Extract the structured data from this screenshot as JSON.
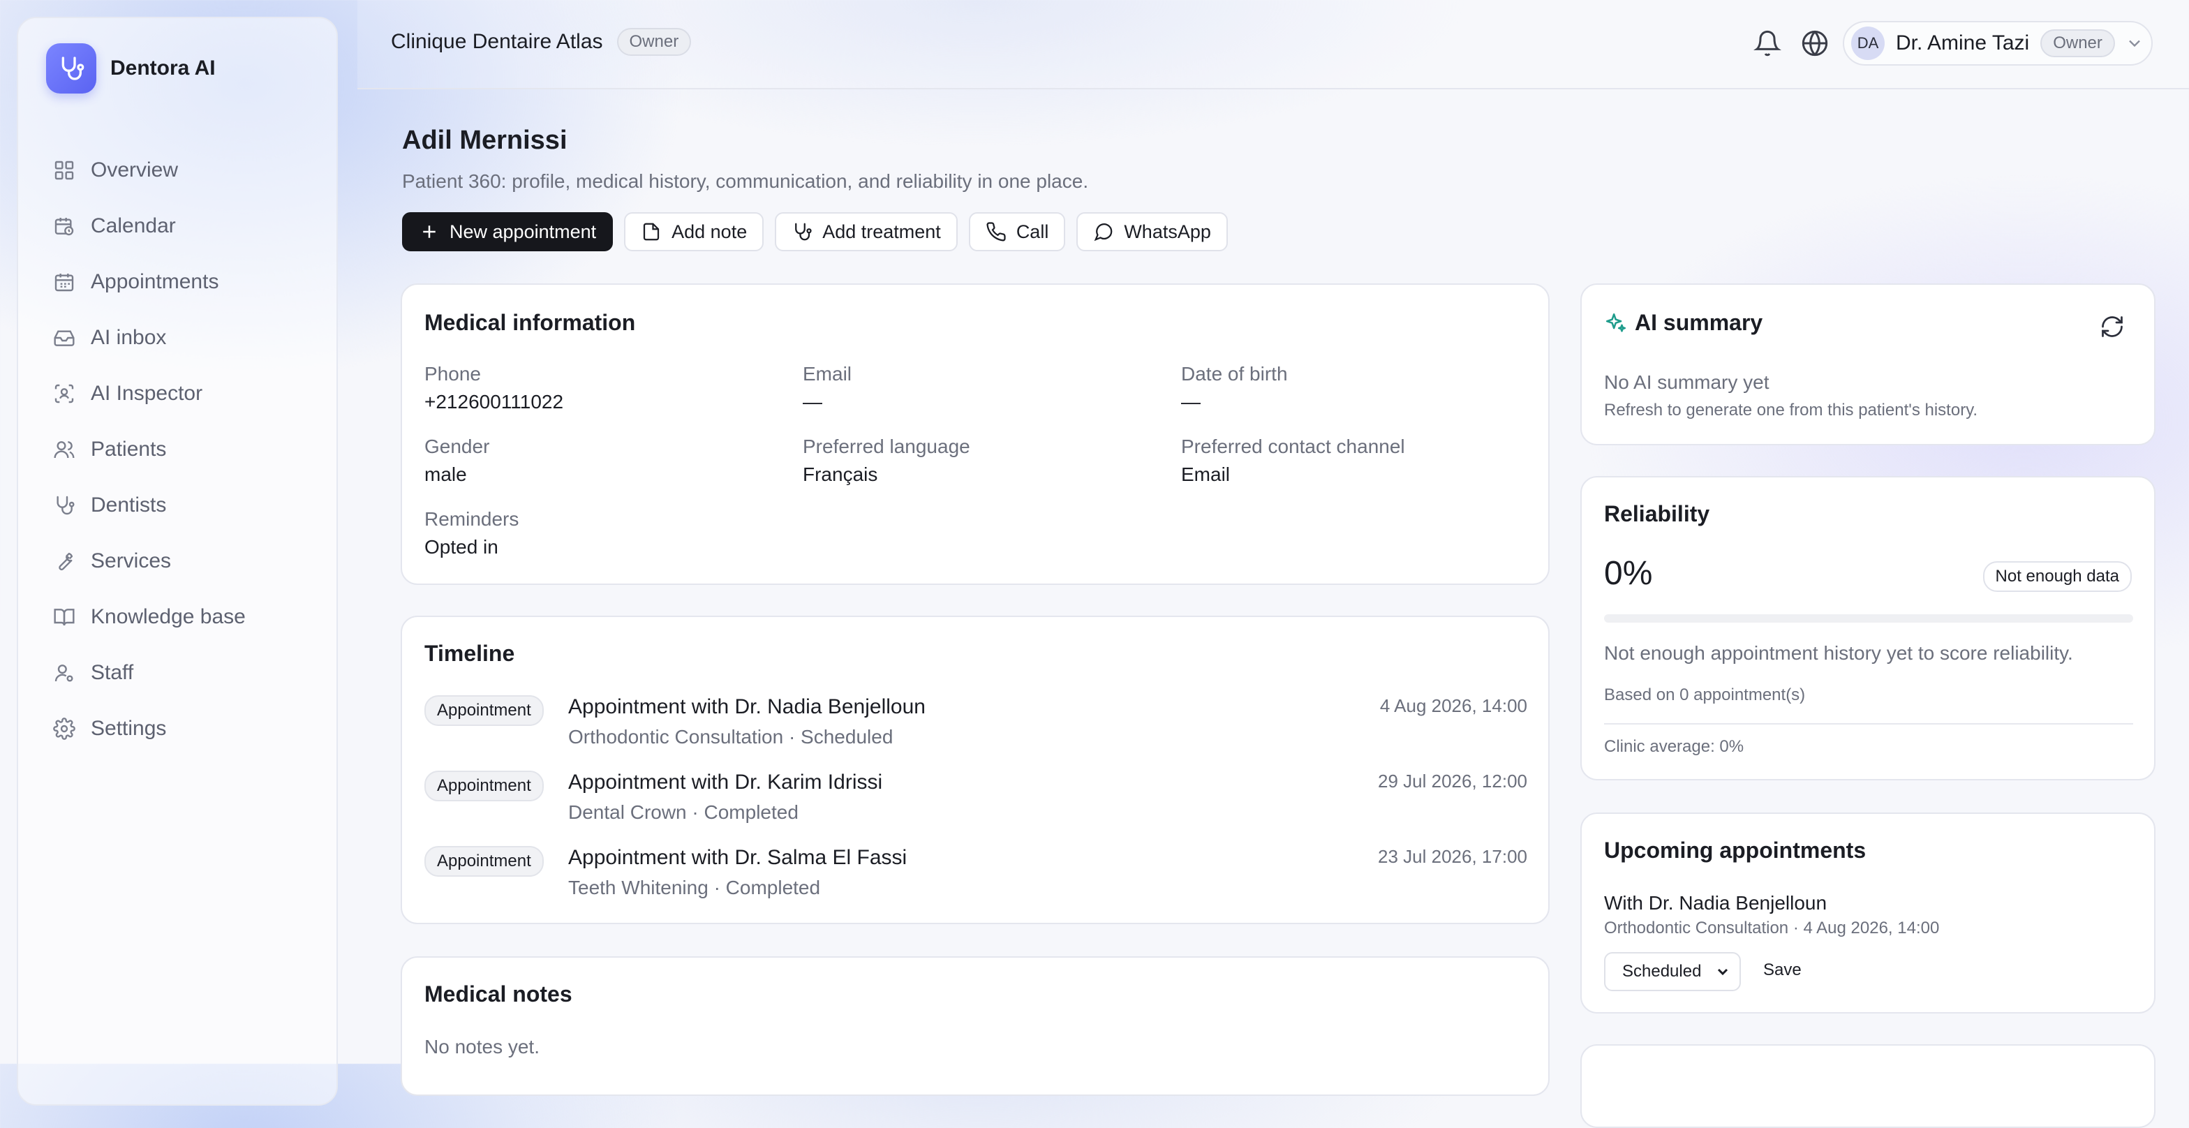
{
  "brand": {
    "name": "Dentora AI",
    "logo_icon": "stethoscope-icon",
    "accent": "#6a72f6"
  },
  "sidebar": {
    "items": [
      {
        "label": "Overview",
        "icon": "grid-icon"
      },
      {
        "label": "Calendar",
        "icon": "calendar-clock-icon"
      },
      {
        "label": "Appointments",
        "icon": "calendar-icon"
      },
      {
        "label": "AI inbox",
        "icon": "inbox-icon"
      },
      {
        "label": "AI Inspector",
        "icon": "scan-face-icon"
      },
      {
        "label": "Patients",
        "icon": "users-icon"
      },
      {
        "label": "Dentists",
        "icon": "stethoscope-icon"
      },
      {
        "label": "Services",
        "icon": "wrench-icon"
      },
      {
        "label": "Knowledge base",
        "icon": "book-icon"
      },
      {
        "label": "Staff",
        "icon": "user-cog-icon"
      },
      {
        "label": "Settings",
        "icon": "gear-icon"
      }
    ]
  },
  "header": {
    "clinic_name": "Clinique Dentaire Atlas",
    "clinic_role": "Owner",
    "user_initials": "DA",
    "user_name": "Dr. Amine Tazi",
    "user_role": "Owner"
  },
  "page": {
    "title": "Adil Mernissi",
    "subtitle": "Patient 360: profile, medical history, communication, and reliability in one place."
  },
  "actions": {
    "new_appointment": "New appointment",
    "add_note": "Add note",
    "add_treatment": "Add treatment",
    "call": "Call",
    "whatsapp": "WhatsApp"
  },
  "medical_info": {
    "title": "Medical information",
    "phone_label": "Phone",
    "phone": "+212600111022",
    "email_label": "Email",
    "email": "—",
    "dob_label": "Date of birth",
    "dob": "—",
    "gender_label": "Gender",
    "gender": "male",
    "language_label": "Preferred language",
    "language": "Français",
    "channel_label": "Preferred contact channel",
    "channel": "Email",
    "reminders_label": "Reminders",
    "reminders": "Opted in"
  },
  "timeline": {
    "title": "Timeline",
    "items": [
      {
        "tag": "Appointment",
        "title": "Appointment with Dr. Nadia Benjelloun",
        "sub": "Orthodontic Consultation · Scheduled",
        "date": "4 Aug 2026, 14:00"
      },
      {
        "tag": "Appointment",
        "title": "Appointment with Dr. Karim Idrissi",
        "sub": "Dental Crown · Completed",
        "date": "29 Jul 2026, 12:00"
      },
      {
        "tag": "Appointment",
        "title": "Appointment with Dr. Salma El Fassi",
        "sub": "Teeth Whitening · Completed",
        "date": "23 Jul 2026, 17:00"
      }
    ]
  },
  "notes": {
    "title": "Medical notes",
    "empty": "No notes yet."
  },
  "ai_summary": {
    "title": "AI summary",
    "empty_title": "No AI summary yet",
    "empty_sub": "Refresh to generate one from this patient's history."
  },
  "reliability": {
    "title": "Reliability",
    "score": "0%",
    "score_fraction": 0,
    "badge": "Not enough data",
    "message": "Not enough appointment history yet to score reliability.",
    "based_on": "Based on 0 appointment(s)",
    "clinic_average": "Clinic average: 0%"
  },
  "upcoming": {
    "title": "Upcoming appointments",
    "item_title": "With Dr. Nadia Benjelloun",
    "item_sub": "Orthodontic Consultation · 4 Aug 2026, 14:00",
    "status_value": "Scheduled",
    "save_label": "Save"
  }
}
